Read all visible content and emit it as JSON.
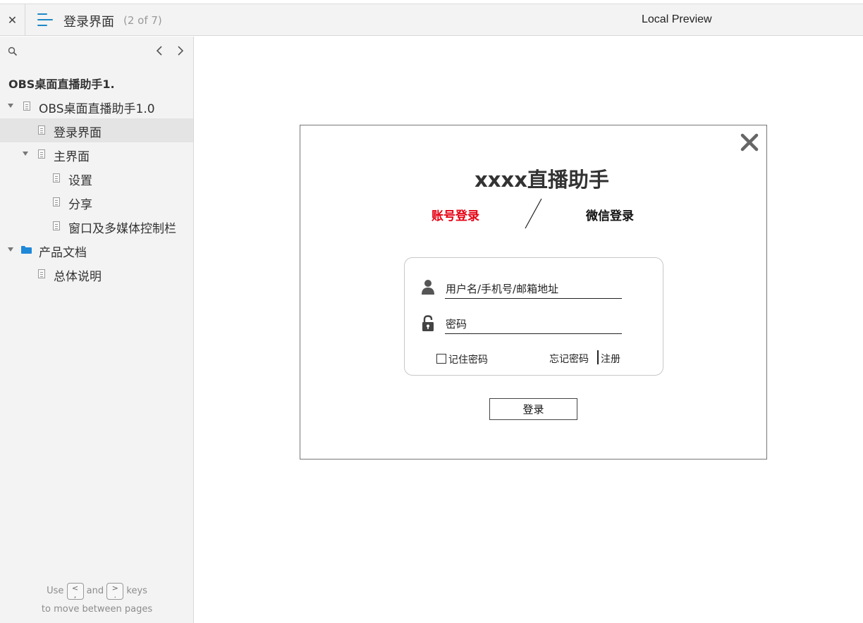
{
  "topbar": {
    "close_label": "✕",
    "page_title": "登录界面",
    "page_count": "(2 of 7)",
    "preview_label": "Local Preview"
  },
  "sidebar": {
    "prev_label": "‹",
    "next_label": "›",
    "project_title": "OBS桌面直播助手1.",
    "tree": [
      {
        "label": "OBS桌面直播助手1.0",
        "icon": "doc-icon",
        "expanded": true,
        "selected": false
      },
      {
        "label": "登录界面",
        "icon": "doc-icon",
        "selected": true
      },
      {
        "label": "主界面",
        "icon": "doc-icon",
        "expanded": true,
        "selected": false
      },
      {
        "label": "设置",
        "icon": "doc-icon",
        "selected": false
      },
      {
        "label": "分享",
        "icon": "doc-icon",
        "selected": false
      },
      {
        "label": "窗口及多媒体控制栏",
        "icon": "doc-icon",
        "selected": false
      },
      {
        "label": "产品文档",
        "icon": "folder-icon",
        "expanded": true,
        "selected": false
      },
      {
        "label": "总体说明",
        "icon": "doc-icon",
        "selected": false
      }
    ],
    "footer": {
      "use": "Use",
      "key_prev": "<\n,",
      "and": "and",
      "key_next": ">\n.",
      "keys": "keys",
      "line2": "to move between pages"
    }
  },
  "dialog": {
    "app_title": "xxxx直播助手",
    "tab_account": "账号登录",
    "tab_wechat": "微信登录",
    "username_placeholder": "用户名/手机号/邮箱地址",
    "password_placeholder": "密码",
    "remember_label": "记住密码",
    "forgot_label": "忘记密码",
    "register_label": "注册",
    "login_label": "登录"
  },
  "colors": {
    "accent": "#1e88c7",
    "active_tab": "#e60012",
    "folder": "#1e88d8"
  }
}
